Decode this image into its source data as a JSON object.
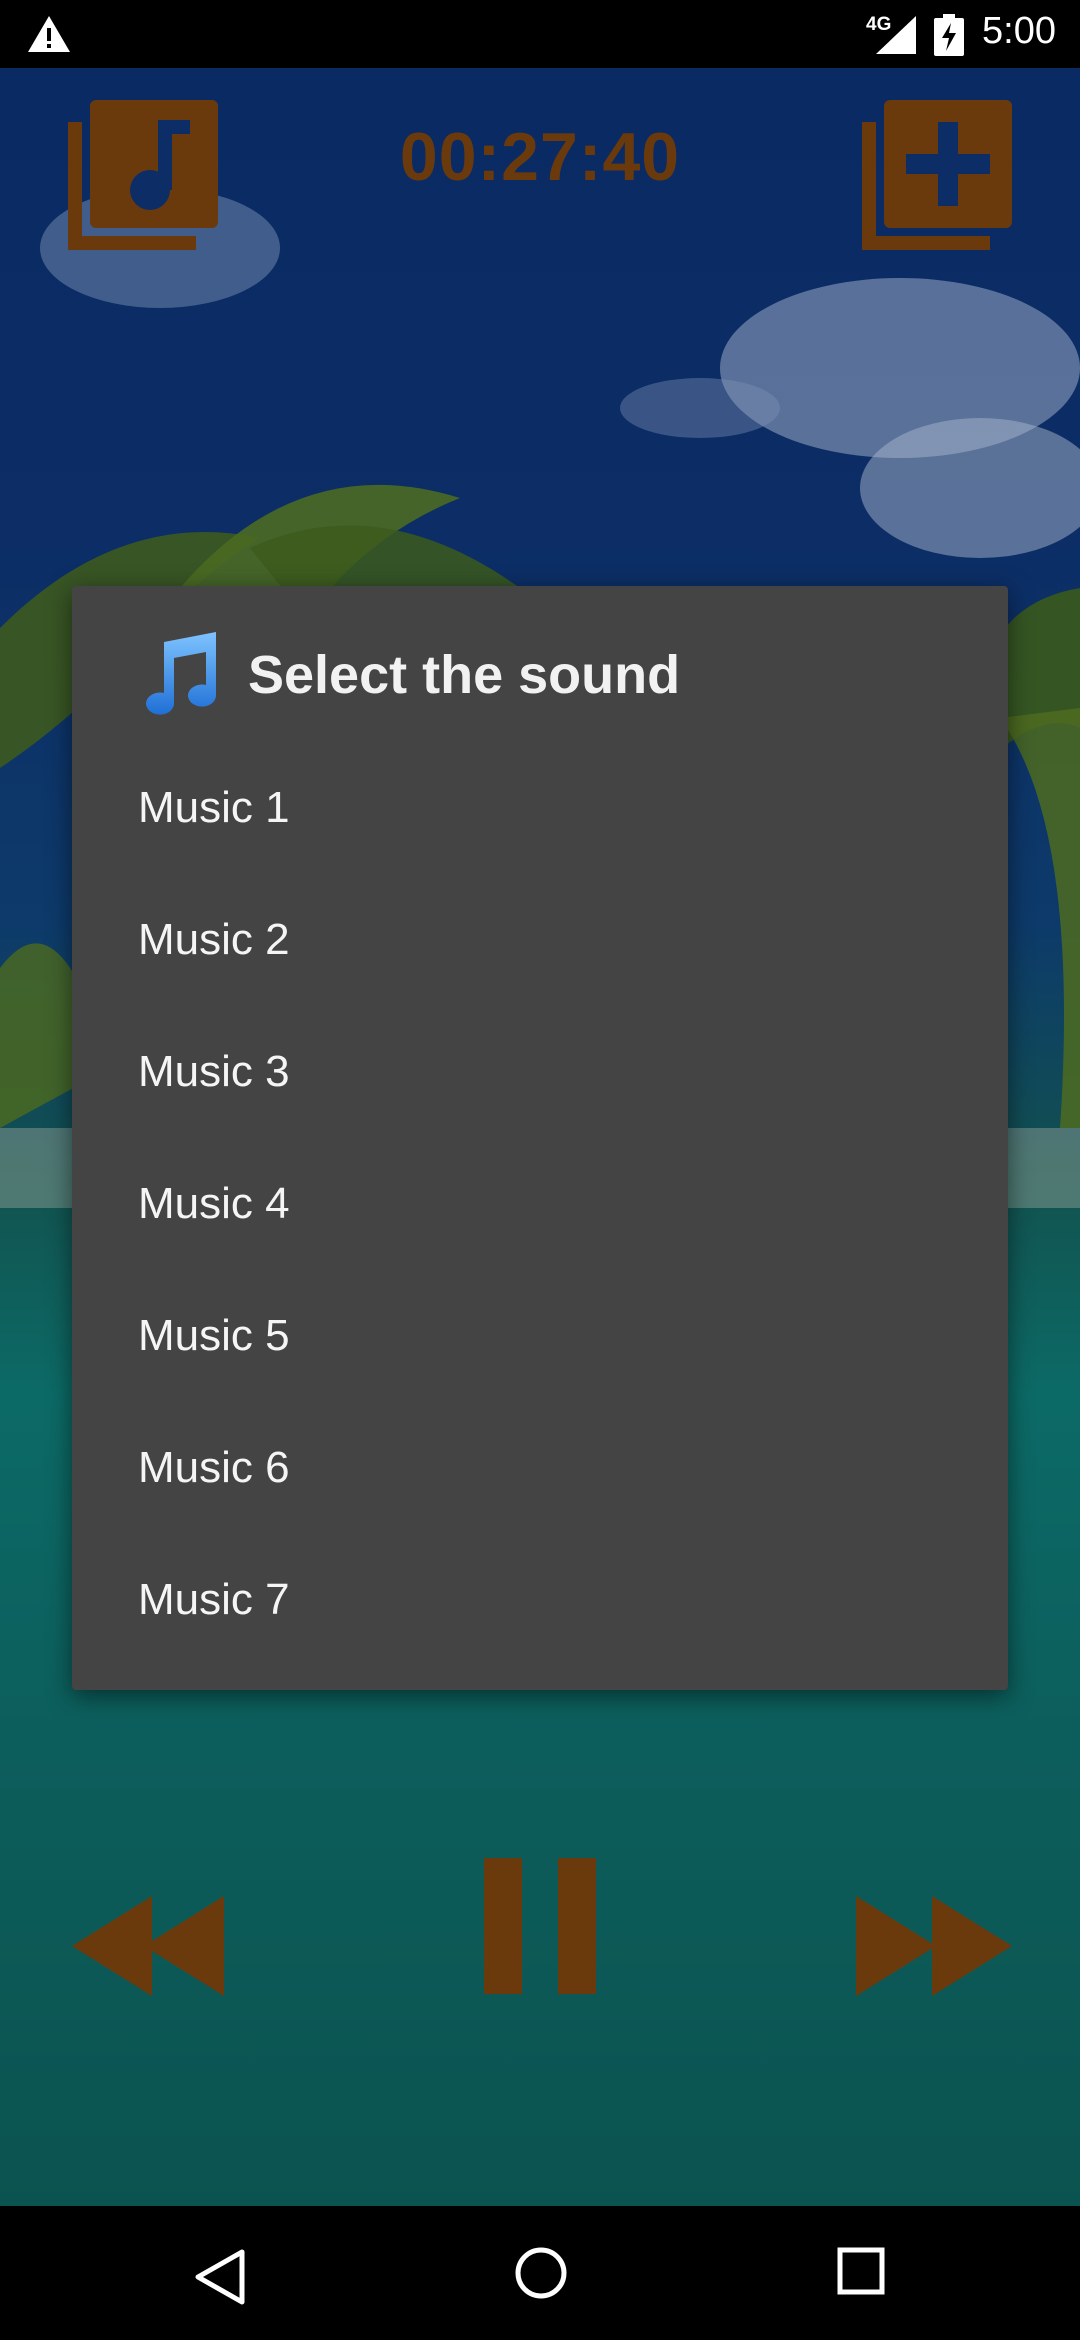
{
  "status_bar": {
    "network_label": "4G",
    "time": "5:00"
  },
  "player": {
    "timer": "00:27:40",
    "accent_color": "#6b3a0c"
  },
  "dialog": {
    "icon": "music-note-icon",
    "title": "Select the sound",
    "items": [
      {
        "label": "Music 1"
      },
      {
        "label": "Music 2"
      },
      {
        "label": "Music 3"
      },
      {
        "label": "Music 4"
      },
      {
        "label": "Music 5"
      },
      {
        "label": "Music 6"
      },
      {
        "label": "Music 7"
      }
    ]
  },
  "nav_bar": {
    "icons": [
      "back-icon",
      "home-icon",
      "recents-icon"
    ]
  }
}
